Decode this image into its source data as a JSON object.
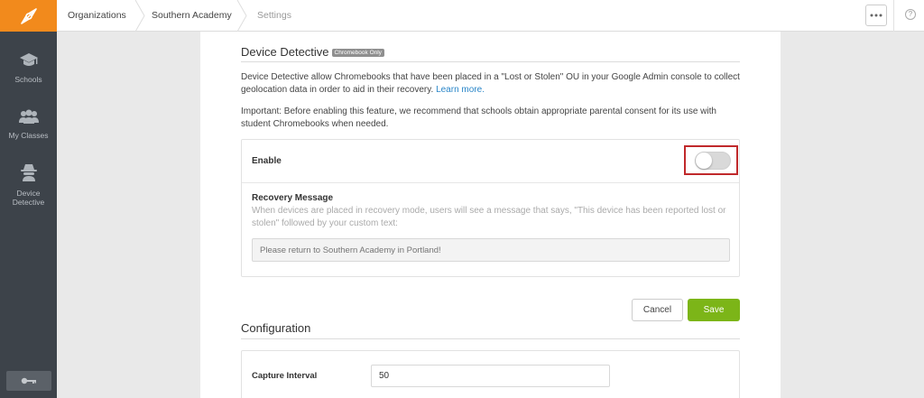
{
  "sidebar": {
    "items": [
      {
        "label": "Schools",
        "icon": "graduation-cap-icon"
      },
      {
        "label": "My Classes",
        "icon": "users-icon"
      },
      {
        "label": "Device Detective",
        "icon": "spy-icon"
      }
    ],
    "bottom_icon": "key-icon"
  },
  "breadcrumb": [
    {
      "label": "Organizations"
    },
    {
      "label": "Southern Academy"
    },
    {
      "label": "Settings"
    }
  ],
  "device_detective": {
    "title": "Device Detective",
    "badge": "Chromebook Only",
    "description": "Device Detective allow Chromebooks that have been placed in a \"Lost or Stolen\" OU in your Google Admin console to collect geolocation data in order to aid in their recovery.",
    "learn_more": "Learn more.",
    "important": "Important: Before enabling this feature, we recommend that schools obtain appropriate parental consent for its use with student Chromebooks when needed.",
    "enable_label": "Enable",
    "enabled": false,
    "recovery_label": "Recovery Message",
    "recovery_help": "When devices are placed in recovery mode, users will see a message that says, \"This device has been reported lost or stolen\" followed by your custom text:",
    "recovery_placeholder": "Please return to Southern Academy in Portland!",
    "cancel_label": "Cancel",
    "save_label": "Save"
  },
  "configuration": {
    "title": "Configuration",
    "capture_interval_label": "Capture Interval",
    "capture_interval_value": "50"
  },
  "colors": {
    "accent_orange": "#f28a1c",
    "save_green": "#7cb518",
    "highlight_red": "#c0292b",
    "sidebar_bg": "#3d434a"
  }
}
